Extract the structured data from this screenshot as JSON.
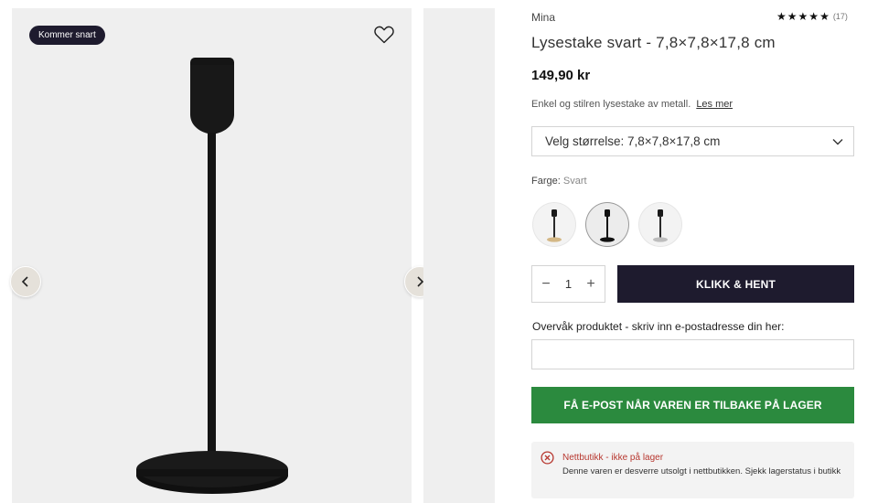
{
  "gallery": {
    "badge": "Kommer snart",
    "icons": {
      "wishlist": "heart-outline-icon",
      "prev": "chevron-left-icon",
      "next": "chevron-right-icon"
    }
  },
  "product": {
    "brand": "Mina",
    "rating_count": "(17)",
    "rating": 5,
    "title": "Lysestake svart - 7,8×7,8×17,8 cm",
    "price": "149,90 kr",
    "description": "Enkel og stilren lysestake av metall.",
    "read_more": "Les mer"
  },
  "size": {
    "selected": "Velg størrelse: 7,8×7,8×17,8 cm"
  },
  "color": {
    "label": "Farge:",
    "value": "Svart",
    "swatches": [
      {
        "name": "gold",
        "color": "#c8a46a",
        "selected": false
      },
      {
        "name": "black",
        "color": "#1b1b1b",
        "selected": true
      },
      {
        "name": "silver",
        "color": "#b9b9b9",
        "selected": false
      }
    ]
  },
  "purchase": {
    "quantity": "1",
    "minus": "−",
    "plus": "+",
    "cta": "KLIKK & HENT"
  },
  "watch": {
    "label": "Overvåk produktet - skriv inn e-postadresse din her:",
    "email_value": "",
    "notify_button": "FÅ E-POST NÅR VAREN ER TILBAKE PÅ LAGER"
  },
  "stock": {
    "title": "Nettbutikk - ikke på lager",
    "text": "Denne varen er desverre utsolgt i nettbutikken. Sjekk lagerstatus i butikk"
  },
  "colors": {
    "dark": "#1e1b2e",
    "green": "#2b8a3e",
    "error": "#b7372f"
  }
}
